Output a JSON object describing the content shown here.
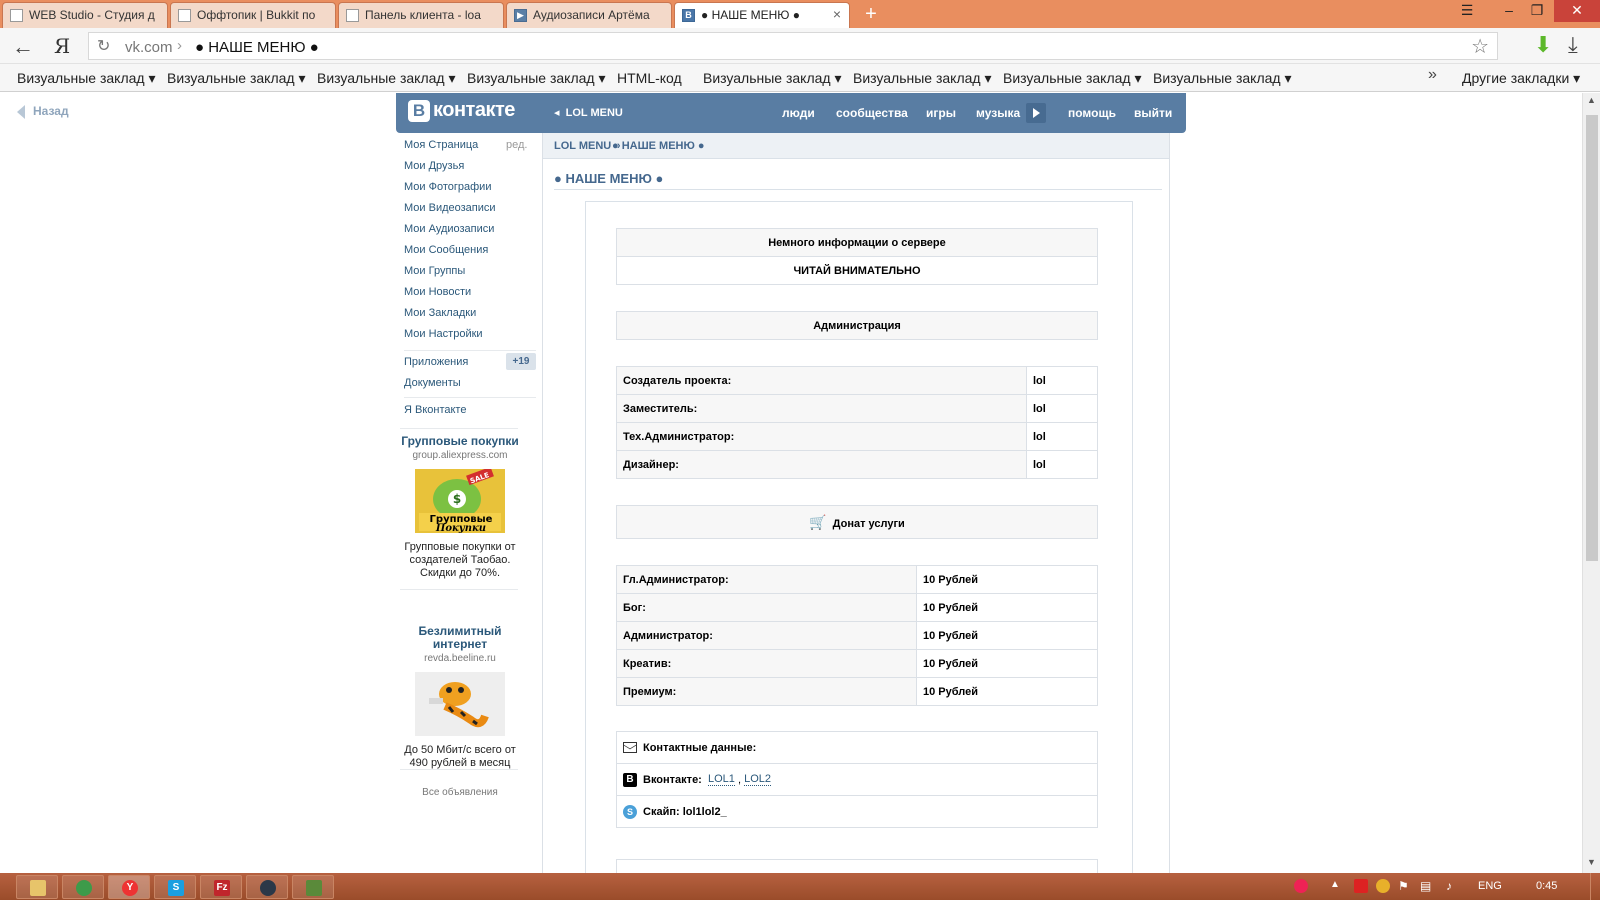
{
  "browser": {
    "tabs": [
      {
        "title": "WEB Studio - Студия д",
        "icon": "page-icon"
      },
      {
        "title": "Оффтопик | Bukkit по",
        "icon": "page-icon"
      },
      {
        "title": "Панель клиента - loa",
        "icon": "page-icon"
      },
      {
        "title": "Аудиозаписи Артёма",
        "icon": "play-icon"
      },
      {
        "title": "● НАШЕ МЕНЮ ●",
        "icon": "vk-icon"
      }
    ],
    "tab_close": "×",
    "new_tab": "+",
    "ya": "Я",
    "url_host": "vk.com",
    "url_sep": "›",
    "url_title": "● НАШЕ МЕНЮ ●",
    "bookmarks": [
      "Визуальные заклад ▾",
      "Визуальные заклад ▾",
      "Визуальные заклад ▾",
      "Визуальные заклад ▾",
      "HTML-код",
      "Визуальные заклад ▾",
      "Визуальные заклад ▾",
      "Визуальные заклад ▾",
      "Визуальные заклад ▾"
    ],
    "bookmarks_more": "»",
    "other_bookmarks": "Другие закладки ▾"
  },
  "back_link": "Назад",
  "vk_header": {
    "logo_letter": "В",
    "logo_text": "контакте",
    "app_back": "LOL MENU",
    "nav": [
      "люди",
      "сообщества",
      "игры",
      "музыка",
      "помощь",
      "выйти"
    ]
  },
  "left_menu": {
    "items": [
      "Моя Страница",
      "Мои Друзья",
      "Мои Фотографии",
      "Мои Видеозаписи",
      "Мои Аудиозаписи",
      "Мои Сообщения",
      "Мои Группы",
      "Мои Новости",
      "Мои Закладки",
      "Мои Настройки"
    ],
    "edit": "ред.",
    "apps": "Приложения",
    "apps_badge": "+19",
    "docs": "Документы",
    "about": "Я Вконтакте"
  },
  "ads": [
    {
      "title": "Групповые покупки",
      "domain": "group.aliexpress.com",
      "image_lettering": "Групповые Покупки SALE",
      "text": "Групповые покупки от создателей Таобао. Скидки до 70%."
    },
    {
      "title": "Безлимитный интернет",
      "domain": "revda.beeline.ru",
      "text": "До 50 Мбит/с всего от 490 рублей в месяц"
    }
  ],
  "ads_all": "Все объявления",
  "breadcrumb": {
    "app": "LOL MENU",
    "sep": "»",
    "page": "● НАШЕ МЕНЮ ●"
  },
  "page_title": "● НАШЕ МЕНЮ ●",
  "wiki": {
    "info_title": "Немного информации о сервере",
    "info_sub": "ЧИТАЙ ВНИМАТЕЛЬНО",
    "admin_title": "Администрация",
    "staff": [
      {
        "role": "Создатель проекта:",
        "name": "lol"
      },
      {
        "role": "Заместитель:",
        "name": "lol"
      },
      {
        "role": "Тех.Администратор:",
        "name": "lol"
      },
      {
        "role": "Дизайнер:",
        "name": "lol"
      }
    ],
    "donate_title": "Донат услуги",
    "prices": [
      {
        "rank": "Гл.Администратор:",
        "price": "10 Рублей"
      },
      {
        "rank": "Бог:",
        "price": "10 Рублей"
      },
      {
        "rank": "Администратор:",
        "price": "10 Рублей"
      },
      {
        "rank": "Креатив:",
        "price": "10 Рублей"
      },
      {
        "rank": "Премиум:",
        "price": "10 Рублей"
      }
    ],
    "contacts_title": "Контактные данные:",
    "vk_label": "Вконтакте:",
    "vk_link1": "LOL1",
    "vk_comma": ",",
    "vk_link2": "LOL2",
    "skype_label": "Скайп:",
    "skype_value": "lol1lol2_"
  },
  "taskbar": {
    "lang": "ENG",
    "time": "0:45"
  },
  "colors": {
    "vk_blue": "#597da3",
    "link": "#2b587a",
    "tabbar": "#e98e5f",
    "taskbar": "#a55430"
  }
}
